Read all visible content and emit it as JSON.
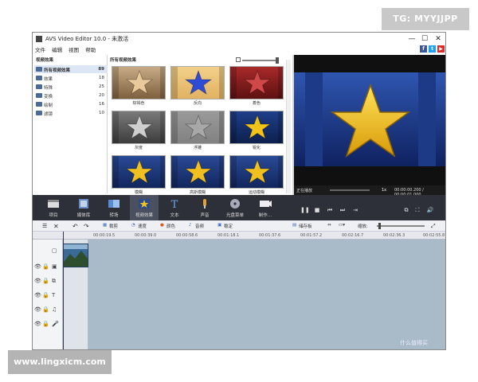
{
  "watermarks": {
    "top": "TG: MYYJJPP",
    "bottom": "www.lingxicm.com",
    "corner": "什么值得买"
  },
  "window": {
    "title": "AVS Video Editor 10.0 - 未激活",
    "min": "—",
    "max": "☐",
    "close": "✕"
  },
  "menu": [
    "文件",
    "编辑",
    "视图",
    "帮助"
  ],
  "social": [
    {
      "label": "f",
      "color": "#3b5998"
    },
    {
      "label": "t",
      "color": "#1da1f2"
    },
    {
      "label": "▶",
      "color": "#e02b2b"
    }
  ],
  "tree": {
    "header": "视频效果",
    "items": [
      {
        "label": "所有视频效果",
        "count": "89",
        "selected": true
      },
      {
        "label": "效果",
        "count": "18"
      },
      {
        "label": "特殊",
        "count": "25"
      },
      {
        "label": "变换",
        "count": "20"
      },
      {
        "label": "绘制",
        "count": "16"
      },
      {
        "label": "滤镜",
        "count": "10"
      }
    ]
  },
  "grid": {
    "header": "所有视频效果",
    "effects": [
      {
        "label": "棕褐色",
        "bg": "#c8ab86",
        "star": "#e8c99a",
        "bg2": "#7a5c3a"
      },
      {
        "label": "反向",
        "bg": "#f2d08a",
        "star": "#2e4bd6",
        "bg2": "#e0b060"
      },
      {
        "label": "着色",
        "bg": "#a82a2a",
        "star": "#d04848",
        "bg2": "#5a1010"
      },
      {
        "label": "灰度",
        "bg": "#7a7a7a",
        "star": "#cfcfcf",
        "bg2": "#3a3a3a"
      },
      {
        "label": "浮雕",
        "bg": "#9a9a9a",
        "star": "#a8a8a8",
        "bg2": "#808080"
      },
      {
        "label": "锐化",
        "bg": "#1f3f8a",
        "star": "#f2c31a",
        "bg2": "#0c1e4a"
      },
      {
        "label": "模糊",
        "bg": "#2a4a96",
        "star": "#f0c020",
        "bg2": "#10245a"
      },
      {
        "label": "高斯模糊",
        "bg": "#2a4a96",
        "star": "#f0c020",
        "bg2": "#10245a"
      },
      {
        "label": "运动模糊",
        "bg": "#2a4a96",
        "star": "#f0c020",
        "bg2": "#10245a"
      }
    ]
  },
  "preview": {
    "status": "正在播放",
    "speed": "1x",
    "time": "00:00:00.200 / 00:00:01.000"
  },
  "toolbar": [
    {
      "label": "项目",
      "icon": "project-icon"
    },
    {
      "label": "媒体库",
      "icon": "media-library-icon"
    },
    {
      "label": "转场",
      "icon": "transition-icon"
    },
    {
      "label": "视频效果",
      "icon": "video-effects-icon",
      "active": true
    },
    {
      "label": "文本",
      "icon": "text-icon"
    },
    {
      "label": "声音",
      "icon": "audio-icon"
    },
    {
      "label": "光盘菜单",
      "icon": "disc-menu-icon"
    },
    {
      "label": "制作…",
      "icon": "produce-icon"
    }
  ],
  "timeline_bar": {
    "items": [
      "裁剪",
      "速度",
      "颜色",
      "音频",
      "稳定"
    ],
    "storyboard": "储存板",
    "zoom_label": "缩放:"
  },
  "ruler": [
    "00:00:19.5",
    "00:00:39.0",
    "00:00:58.6",
    "00:01:18.1",
    "00:01:37.6",
    "00:01:57.2",
    "00:02:16.7",
    "00:02:36.3",
    "00:02:55.8"
  ]
}
